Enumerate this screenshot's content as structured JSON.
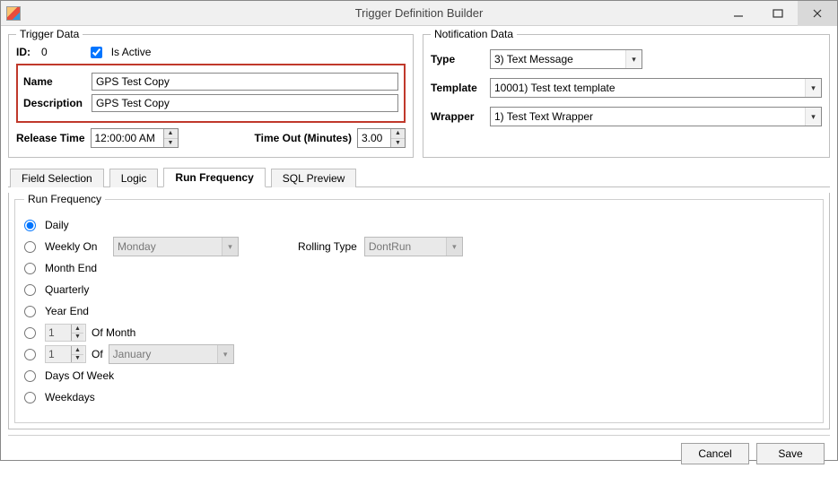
{
  "window": {
    "title": "Trigger Definition Builder"
  },
  "trigger_data": {
    "legend": "Trigger Data",
    "id_label": "ID:",
    "id_value": "0",
    "is_active_label": "Is Active",
    "is_active_checked": true,
    "name_label": "Name",
    "name_value": "GPS Test Copy",
    "description_label": "Description",
    "description_value": "GPS Test Copy",
    "release_time_label": "Release Time",
    "release_time_value": "12:00:00 AM",
    "timeout_label": "Time Out (Minutes)",
    "timeout_value": "3.00"
  },
  "notification_data": {
    "legend": "Notification Data",
    "type_label": "Type",
    "type_value": "3) Text Message",
    "template_label": "Template",
    "template_value": "10001) Test text template",
    "wrapper_label": "Wrapper",
    "wrapper_value": "1) Test Text Wrapper"
  },
  "tabs": {
    "field_selection": "Field Selection",
    "logic": "Logic",
    "run_frequency": "Run Frequency",
    "sql_preview": "SQL Preview",
    "active": "run_frequency"
  },
  "run_frequency": {
    "legend": "Run Frequency",
    "selected": "daily",
    "daily": "Daily",
    "weekly_on": "Weekly On",
    "weekly_on_value": "Monday",
    "rolling_type_label": "Rolling Type",
    "rolling_type_value": "DontRun",
    "month_end": "Month End",
    "quarterly": "Quarterly",
    "year_end": "Year End",
    "of_month_value": "1",
    "of_month_suffix": "Of Month",
    "of_value": "1",
    "of_label": "Of",
    "of_month_name": "January",
    "days_of_week": "Days Of Week",
    "weekdays": "Weekdays"
  },
  "buttons": {
    "cancel": "Cancel",
    "save": "Save"
  }
}
